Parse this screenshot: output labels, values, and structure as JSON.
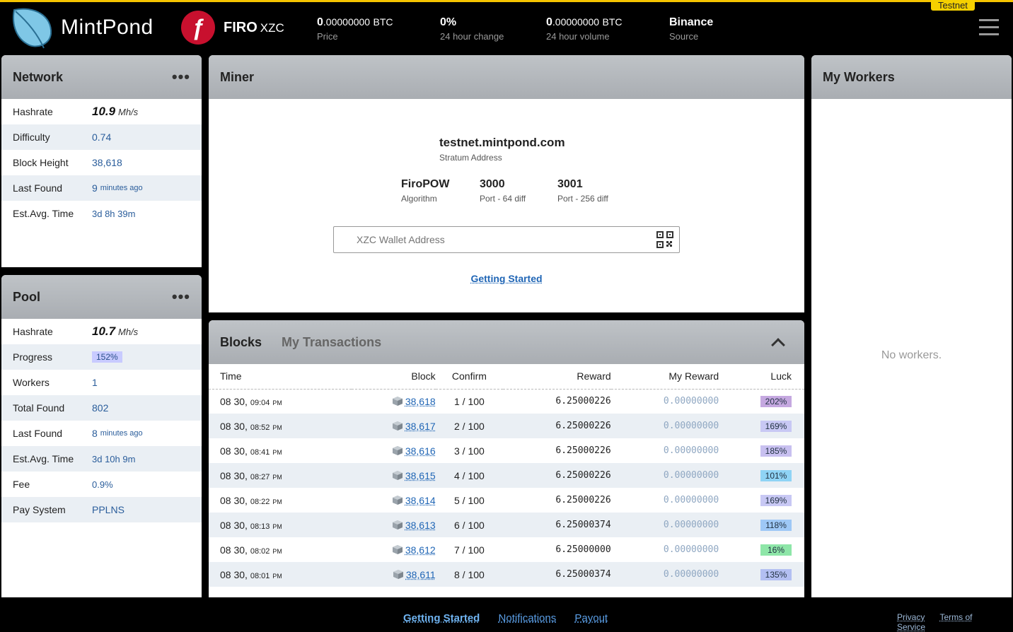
{
  "header": {
    "brand": "MintPond",
    "coin_name": "FIRO",
    "coin_symbol": "XZC",
    "stats": [
      {
        "big": "0",
        "small": ".00000000",
        "unit": "BTC",
        "label": "Price"
      },
      {
        "big": "0",
        "small": "%",
        "unit": "",
        "label": "24 hour change"
      },
      {
        "big": "0",
        "small": ".00000000",
        "unit": "BTC",
        "label": "24 hour volume"
      },
      {
        "big": "Binance",
        "small": "",
        "unit": "",
        "label": "Source"
      }
    ],
    "badge": "Testnet"
  },
  "network": {
    "title": "Network",
    "rows": [
      {
        "label": "Hashrate",
        "value": "10.9",
        "unit": "Mh/s"
      },
      {
        "label": "Difficulty",
        "value": "0.74"
      },
      {
        "label": "Block Height",
        "value": "38,618"
      },
      {
        "label": "Last Found",
        "value": "9",
        "unit": "minutes ago"
      },
      {
        "label": "Est.Avg. Time",
        "value": "3d 8h 39m"
      }
    ]
  },
  "pool": {
    "title": "Pool",
    "rows": [
      {
        "label": "Hashrate",
        "value": "10.7",
        "unit": "Mh/s"
      },
      {
        "label": "Progress",
        "value": "152%"
      },
      {
        "label": "Workers",
        "value": "1"
      },
      {
        "label": "Total Found",
        "value": "802"
      },
      {
        "label": "Last Found",
        "value": "8",
        "unit": "minutes ago"
      },
      {
        "label": "Est.Avg. Time",
        "value": "3d 10h 9m"
      },
      {
        "label": "Fee",
        "value": "0.9%"
      },
      {
        "label": "Pay System",
        "value": "PPLNS"
      }
    ]
  },
  "miner": {
    "title": "Miner",
    "stratum": "testnet.mintpond.com",
    "stratum_label": "Stratum Address",
    "algo": "FiroPOW",
    "algo_label": "Algorithm",
    "port1": "3000",
    "port1_label": "Port - 64 diff",
    "port2": "3001",
    "port2_label": "Port - 256 diff",
    "wallet_placeholder": "XZC Wallet Address",
    "getting_started": "Getting Started"
  },
  "blocks": {
    "tab_blocks": "Blocks",
    "tab_tx": "My Transactions",
    "columns": [
      "Time",
      "Block",
      "Confirm",
      "Reward",
      "My Reward",
      "Luck"
    ],
    "rows": [
      {
        "date": "08 30,",
        "time": "09:04",
        "ampm": "PM",
        "block": "38,618",
        "confirm": "1 / 100",
        "reward": "6.25000226",
        "my": "0.00000000",
        "luck": "202%",
        "luck_color": "#c5a8e0"
      },
      {
        "date": "08 30,",
        "time": "08:52",
        "ampm": "PM",
        "block": "38,617",
        "confirm": "2 / 100",
        "reward": "6.25000226",
        "my": "0.00000000",
        "luck": "169%",
        "luck_color": "#c8c8f4"
      },
      {
        "date": "08 30,",
        "time": "08:41",
        "ampm": "PM",
        "block": "38,616",
        "confirm": "3 / 100",
        "reward": "6.25000226",
        "my": "0.00000000",
        "luck": "185%",
        "luck_color": "#c8c0f0"
      },
      {
        "date": "08 30,",
        "time": "08:27",
        "ampm": "PM",
        "block": "38,615",
        "confirm": "4 / 100",
        "reward": "6.25000226",
        "my": "0.00000000",
        "luck": "101%",
        "luck_color": "#8fd3f5"
      },
      {
        "date": "08 30,",
        "time": "08:22",
        "ampm": "PM",
        "block": "38,614",
        "confirm": "5 / 100",
        "reward": "6.25000226",
        "my": "0.00000000",
        "luck": "169%",
        "luck_color": "#c8c8f4"
      },
      {
        "date": "08 30,",
        "time": "08:13",
        "ampm": "PM",
        "block": "38,613",
        "confirm": "6 / 100",
        "reward": "6.25000374",
        "my": "0.00000000",
        "luck": "118%",
        "luck_color": "#9ec8f6"
      },
      {
        "date": "08 30,",
        "time": "08:02",
        "ampm": "PM",
        "block": "38,612",
        "confirm": "7 / 100",
        "reward": "6.25000000",
        "my": "0.00000000",
        "luck": "16%",
        "luck_color": "#8ee6a8"
      },
      {
        "date": "08 30,",
        "time": "08:01",
        "ampm": "PM",
        "block": "38,611",
        "confirm": "8 / 100",
        "reward": "6.25000374",
        "my": "0.00000000",
        "luck": "135%",
        "luck_color": "#b3bff2"
      }
    ]
  },
  "workers": {
    "title": "My Workers",
    "empty": "No workers."
  },
  "footer": {
    "links": [
      "Getting Started",
      "Notifications",
      "Payout"
    ],
    "legal": [
      "Privacy",
      "Terms of Service"
    ]
  },
  "icons": {
    "logo": "leaf-logo-icon",
    "coin": "firo-coin-icon",
    "menu": "hamburger-menu-icon",
    "qr": "qr-code-icon",
    "block": "cube-icon"
  }
}
